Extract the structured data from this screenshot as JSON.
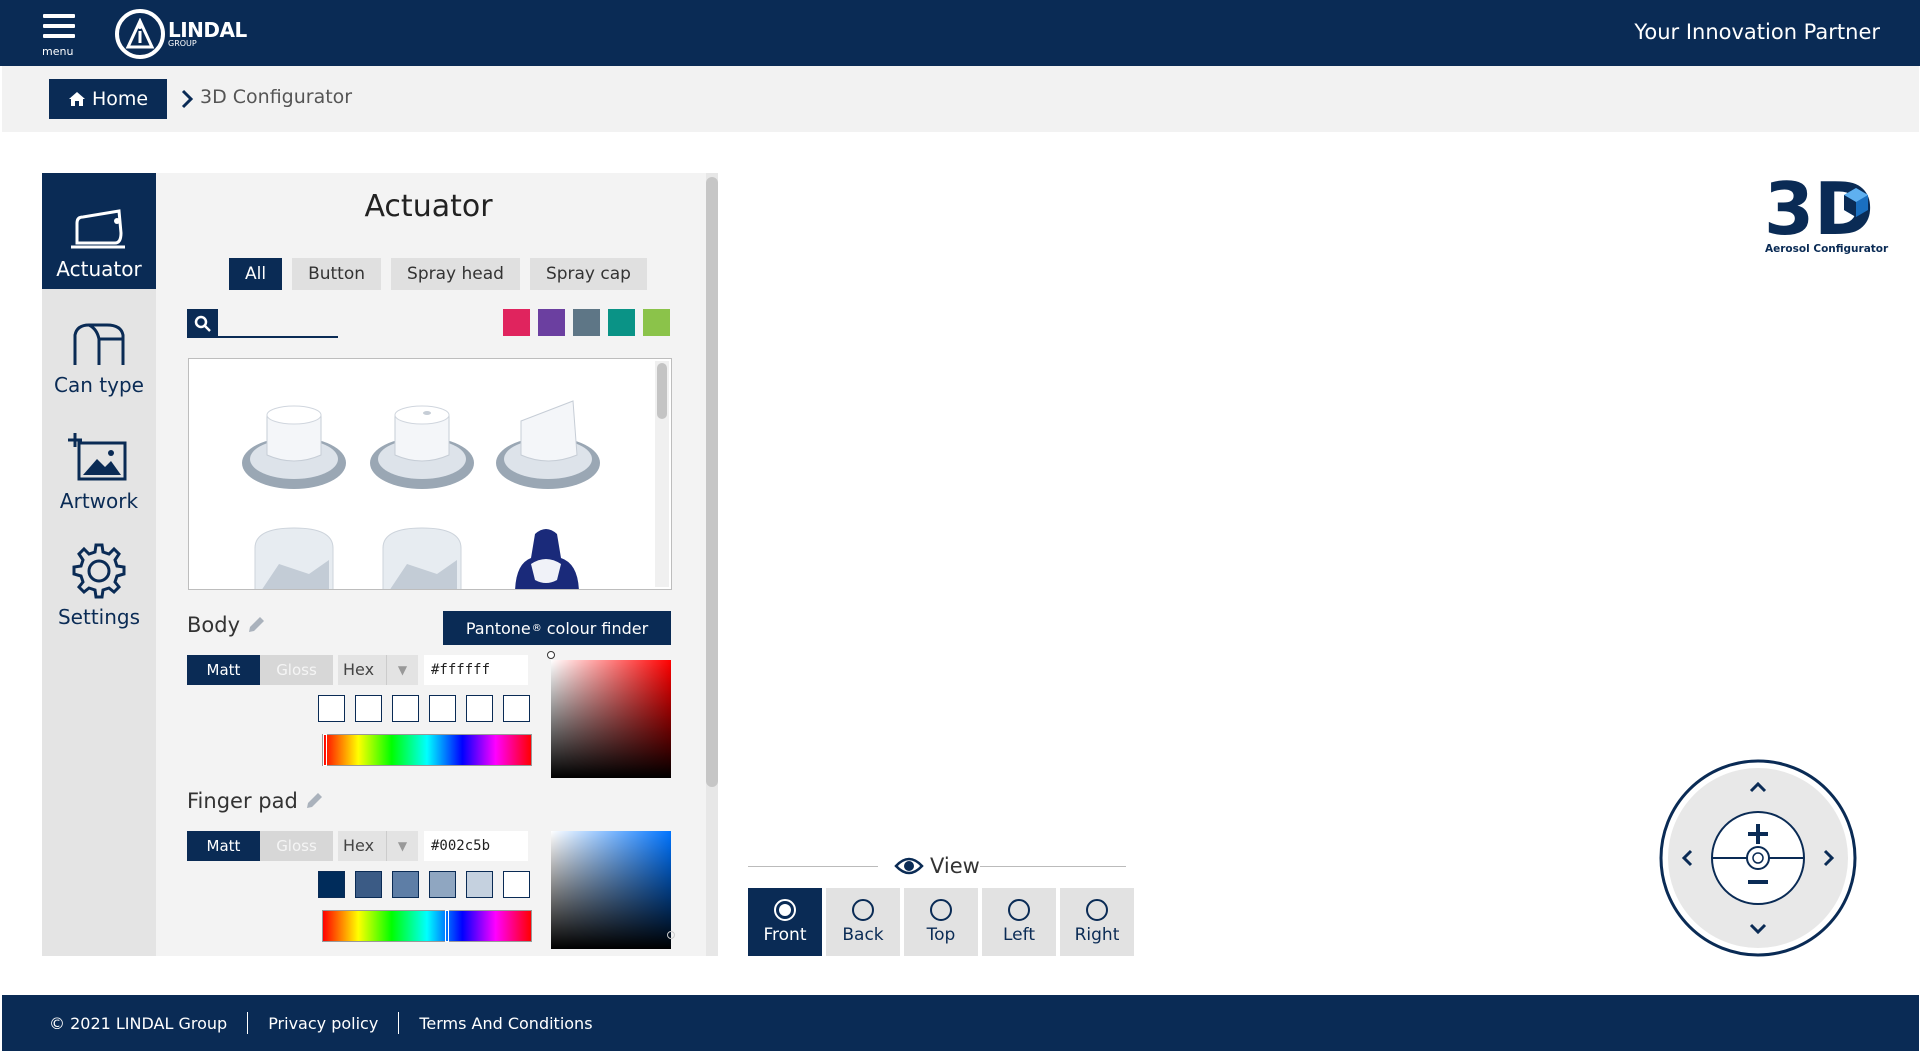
{
  "header": {
    "menu_label": "menu",
    "logo_name": "LINDAL",
    "logo_sub": "GROUP",
    "tagline": "Your Innovation Partner"
  },
  "breadcrumb": {
    "home": "Home",
    "current": "3D Configurator"
  },
  "sidebar": {
    "items": [
      {
        "label": "Actuator",
        "icon": "actuator-icon",
        "active": true
      },
      {
        "label": "Can type",
        "icon": "can-type-icon",
        "active": false
      },
      {
        "label": "Artwork",
        "icon": "artwork-icon",
        "active": false
      },
      {
        "label": "Settings",
        "icon": "gear-icon",
        "active": false
      }
    ]
  },
  "panel": {
    "title": "Actuator",
    "tabs": [
      "All",
      "Button",
      "Spray head",
      "Spray cap"
    ],
    "active_tab": "All",
    "search": {
      "value": "",
      "placeholder": ""
    },
    "color_filters": [
      "#e0245e",
      "#6b3fa0",
      "#5e7686",
      "#0a9386",
      "#8bc34a"
    ],
    "pantone_button": {
      "text": "Pantone",
      "reg": "®",
      "suffix": "colour finder"
    },
    "body": {
      "label": "Body",
      "finish_options": [
        "Matt",
        "Gloss"
      ],
      "finish_selected": "Matt",
      "format": "Hex",
      "value": "#ffffff",
      "chips": [
        "#ffffff",
        "#ffffff",
        "#ffffff",
        "#ffffff",
        "#ffffff",
        "#ffffff"
      ],
      "hue_position": 0
    },
    "finger_pad": {
      "label": "Finger pad",
      "finish_options": [
        "Matt",
        "Gloss"
      ],
      "finish_selected": "Matt",
      "format": "Hex",
      "value": "#002c5b",
      "chips": [
        "#002c5b",
        "#3b5b85",
        "#5e7ea6",
        "#8fa6c1",
        "#c5d1df",
        "#ffffff"
      ],
      "hue_position": 0.6
    }
  },
  "view": {
    "label": "View",
    "options": [
      "Front",
      "Back",
      "Top",
      "Left",
      "Right"
    ],
    "selected": "Front"
  },
  "brand": {
    "mark": "3D",
    "sub": "Aerosol Configurator"
  },
  "footer": {
    "copyright": "© 2021 LINDAL Group",
    "privacy": "Privacy policy",
    "terms": "Terms And Conditions"
  },
  "colors": {
    "navy": "#0a2b55"
  }
}
